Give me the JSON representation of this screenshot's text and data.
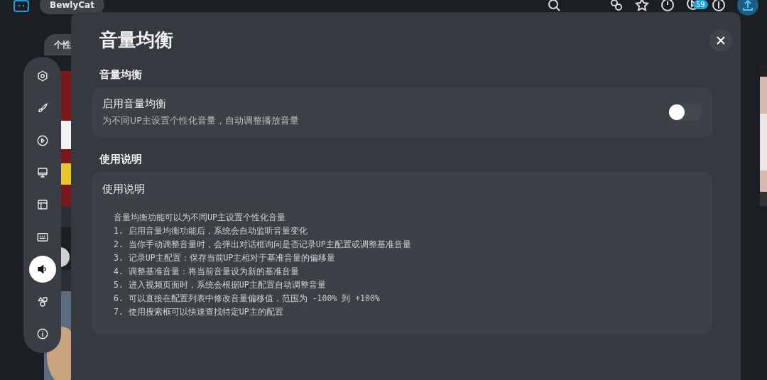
{
  "top_bar": {
    "tabs": [
      {
        "label": "BewlyCat",
        "selected": true
      }
    ],
    "badge": "59"
  },
  "sub_tabs": [
    {
      "label": "个性",
      "selected": true
    }
  ],
  "sidebar": {
    "items": [
      {
        "kind": "gear",
        "selected": false
      },
      {
        "kind": "brush",
        "selected": false
      },
      {
        "kind": "play",
        "selected": false
      },
      {
        "kind": "monitor",
        "selected": false
      },
      {
        "kind": "layout",
        "selected": false
      },
      {
        "kind": "keyboard",
        "selected": false
      },
      {
        "kind": "volume",
        "selected": true
      },
      {
        "kind": "shapes",
        "selected": false
      },
      {
        "kind": "info",
        "selected": false
      }
    ]
  },
  "dialog": {
    "title": "音量均衡",
    "sections": [
      {
        "heading": "音量均衡",
        "kind": "toggle",
        "label": "启用音量均衡",
        "description": "为不同UP主设置个性化音量，自动调整播放音量",
        "on": false
      },
      {
        "heading": "使用说明",
        "kind": "text",
        "label": "使用说明",
        "intro": "音量均衡功能可以为不同UP主设置个性化音量",
        "lines": [
          "1. 启用音量均衡功能后，系统会自动监听音量变化",
          "2. 当你手动调整音量时，会弹出对话框询问是否记录UP主配置或调整基准音量",
          "3. 记录UP主配置：保存当前UP主相对于基准音量的偏移量",
          "4. 调整基准音量：将当前音量设为新的基准音量",
          "5. 进入视频页面时，系统会根据UP主配置自动调整音量",
          "6. 可以直接在配置列表中修改音量偏移值，范围为 -100% 到 +100%",
          "7. 使用搜索框可以快速查找特定UP主的配置"
        ]
      }
    ]
  }
}
